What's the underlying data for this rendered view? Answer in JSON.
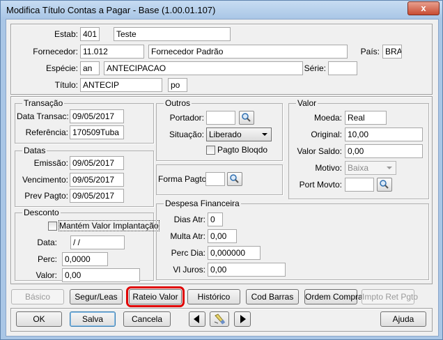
{
  "window": {
    "title": "Modifica Título Contas a Pagar - Base (1.00.01.107)",
    "close_glyph": "x"
  },
  "header": {
    "estab": {
      "label": "Estab:",
      "code": "401",
      "name": "Teste"
    },
    "fornecedor": {
      "label": "Fornecedor:",
      "code": "11.012",
      "name": "Fornecedor Padrão"
    },
    "pais": {
      "label": "País:",
      "value": "BRA"
    },
    "especie": {
      "label": "Espécie:",
      "code": "an",
      "name": "ANTECIPACAO"
    },
    "serie": {
      "label": "Série:",
      "value": ""
    },
    "titulo": {
      "label": "Título:",
      "value": "ANTECIP",
      "parcela": "po"
    }
  },
  "transacao": {
    "legend": "Transação",
    "data_transac": {
      "label": "Data Transac:",
      "value": "09/05/2017"
    },
    "referencia": {
      "label": "Referência:",
      "value": "170509Tuba"
    }
  },
  "datas": {
    "legend": "Datas",
    "emissao": {
      "label": "Emissão:",
      "value": "09/05/2017"
    },
    "vencimento": {
      "label": "Vencimento:",
      "value": "09/05/2017"
    },
    "prev_pagto": {
      "label": "Prev Pagto:",
      "value": "09/05/2017"
    }
  },
  "desconto": {
    "legend": "Desconto",
    "mantem_label": "Mantém Valor Implantação",
    "data": {
      "label": "Data:",
      "value": " /  /"
    },
    "perc": {
      "label": "Perc:",
      "value": "0,0000"
    },
    "valor": {
      "label": "Valor:",
      "value": "0,00"
    }
  },
  "outros": {
    "legend": "Outros",
    "portador": {
      "label": "Portador:",
      "value": ""
    },
    "situacao": {
      "label": "Situação:",
      "value": "Liberado"
    },
    "pagto_bloqdo": "Pagto Bloqdo",
    "forma_pagto": {
      "label": "Forma Pagto:",
      "value": ""
    }
  },
  "valor": {
    "legend": "Valor",
    "moeda": {
      "label": "Moeda:",
      "value": "Real"
    },
    "original": {
      "label": "Original:",
      "value": "10,00"
    },
    "valor_saldo": {
      "label": "Valor Saldo:",
      "value": "0,00"
    },
    "motivo": {
      "label": "Motivo:",
      "value": "Baixa"
    },
    "port_movto": {
      "label": "Port Movto:",
      "value": ""
    }
  },
  "despesa": {
    "legend": "Despesa Financeira",
    "dias_atr": {
      "label": "Dias Atr:",
      "value": "0"
    },
    "multa_atr": {
      "label": "Multa Atr:",
      "value": "0,00"
    },
    "perc_dia": {
      "label": "Perc Dia:",
      "value": "0,000000"
    },
    "vl_juros": {
      "label": "Vl Juros:",
      "value": "0,00"
    }
  },
  "tabs": {
    "basico": "Básico",
    "segur_leas": "Segur/Leas",
    "rateio_valor": "Rateio Valor",
    "historico": "Histórico",
    "cod_barras": "Cod Barras",
    "ordem_compra": "Ordem Compra",
    "impto_ret": "Impto Ret Pgto"
  },
  "actions": {
    "ok": "OK",
    "salva": "Salva",
    "cancela": "Cancela",
    "ajuda": "Ajuda"
  },
  "colors": {
    "highlight": "#e00000",
    "window_frame": "#a9c6e6"
  }
}
